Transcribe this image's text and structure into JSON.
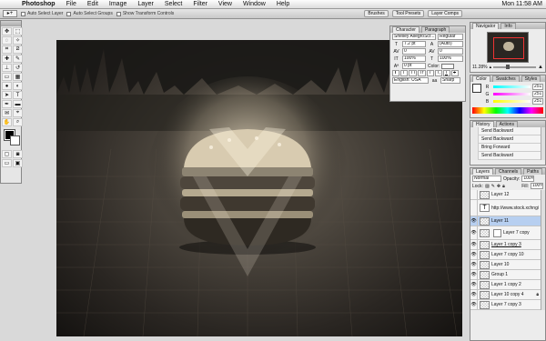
{
  "menubar": {
    "apple": "",
    "items": [
      "Photoshop",
      "File",
      "Edit",
      "Image",
      "Layer",
      "Select",
      "Filter",
      "View",
      "Window",
      "Help"
    ],
    "clock": "Mon 11:58 AM"
  },
  "options": {
    "auto_select_layer": "Auto Select Layer",
    "auto_select_groups": "Auto Select Groups",
    "show_transform": "Show Transform Controls",
    "wells": [
      "Brushes",
      "Tool Presets",
      "Layer Comps"
    ]
  },
  "character": {
    "tabs": [
      "Character",
      "Paragraph"
    ],
    "font_family": "Shelley AllegroScr...",
    "font_style": "Regular",
    "size": "7.2 pt",
    "leading": "(Auto)",
    "kerning": "0",
    "tracking": "0",
    "vscale": "100%",
    "hscale": "100%",
    "baseline": "0 pt",
    "color_label": "Color:",
    "language": "English: USA",
    "antialias": "Sharp",
    "style_buttons": [
      "T",
      "T",
      "TT",
      "Tr",
      "T'",
      "T,",
      "T",
      "T"
    ]
  },
  "navigator": {
    "tabs": [
      "Navigator",
      "Info"
    ],
    "zoom": "11.28%"
  },
  "color_panel": {
    "tabs": [
      "Color",
      "Swatches",
      "Styles"
    ],
    "channels": [
      {
        "name": "R",
        "value": "251"
      },
      {
        "name": "G",
        "value": "251"
      },
      {
        "name": "B",
        "value": "251"
      }
    ]
  },
  "history": {
    "tabs": [
      "History",
      "Actions"
    ],
    "items": [
      "Send Backward",
      "Send Backward",
      "Bring Forward",
      "Send Backward"
    ]
  },
  "layers": {
    "tabs": [
      "Layers",
      "Channels",
      "Paths"
    ],
    "blend_mode": "Normal",
    "opacity_label": "Opacity:",
    "opacity": "100%",
    "lock_label": "Lock:",
    "fill_label": "Fill:",
    "fill": "100%",
    "rows": [
      {
        "name": "Layer 12",
        "type": "pixel",
        "selected": false
      },
      {
        "name": "http://www.stock.xchng/photo/1181...",
        "type": "text",
        "selected": false
      },
      {
        "name": "Layer 11",
        "type": "pixel",
        "selected": true
      },
      {
        "name": "Layer 7 copy",
        "type": "mask",
        "selected": false
      },
      {
        "name": "Layer 1 copy 3",
        "type": "pixel",
        "selected": false
      },
      {
        "name": "Layer 7 copy 10",
        "type": "pixel",
        "selected": false
      },
      {
        "name": "Layer 10",
        "type": "pixel",
        "selected": false
      },
      {
        "name": "Group 1",
        "type": "pixel",
        "selected": false
      },
      {
        "name": "Layer 1 copy 2",
        "type": "pixel",
        "selected": false
      },
      {
        "name": "Layer 10 copy 4",
        "type": "pixel",
        "selected": false
      },
      {
        "name": "Layer 7 copy 3",
        "type": "pixel",
        "selected": false
      }
    ]
  },
  "colors": {
    "selection": "#b7cff0",
    "accent": "#3b78d8"
  }
}
